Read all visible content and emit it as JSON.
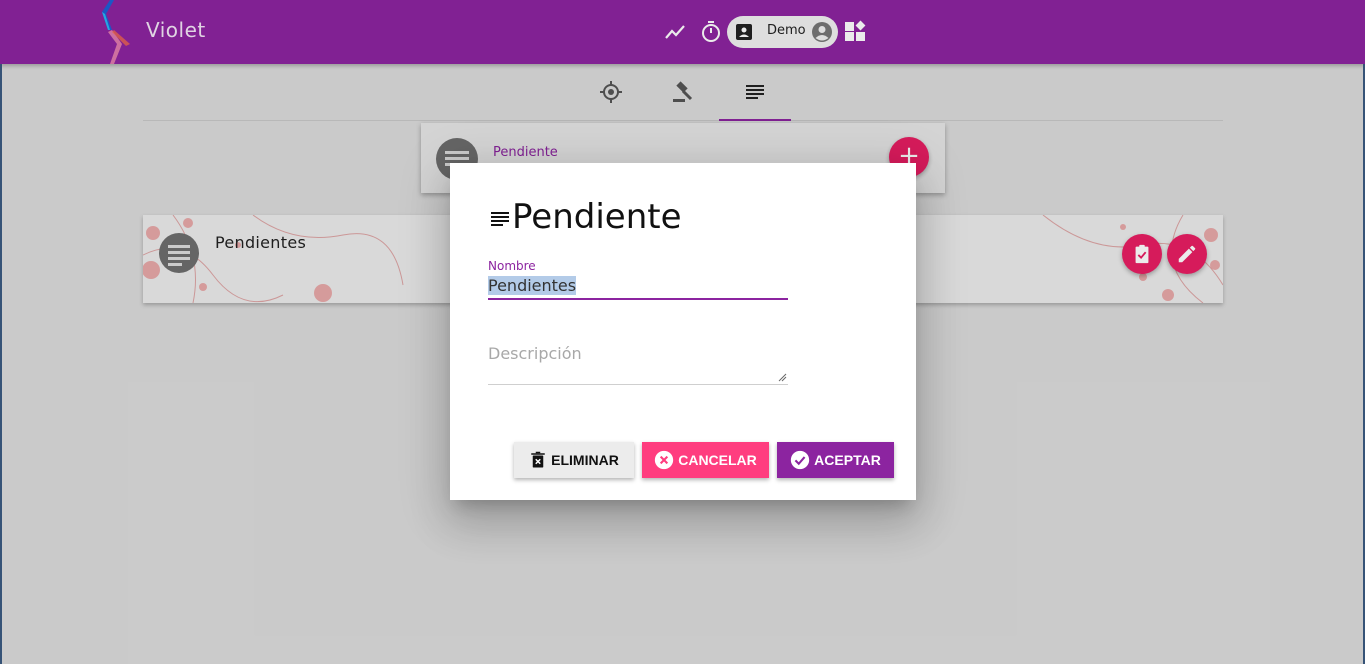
{
  "app": {
    "title": "Violet",
    "user_name": "Demo"
  },
  "tabs": [
    {
      "icon": "target-icon",
      "active": false
    },
    {
      "icon": "gavel-icon",
      "active": false
    },
    {
      "icon": "list-icon",
      "active": true
    }
  ],
  "category_card": {
    "label": "Pendiente",
    "add_button": "+"
  },
  "list_card": {
    "title": "Pendientes"
  },
  "dialog": {
    "title": "Pendiente",
    "name_label": "Nombre",
    "name_value": "Pendientes",
    "description_placeholder": "Descripción",
    "delete_label": "ELIMINAR",
    "cancel_label": "CANCELAR",
    "accept_label": "ACEPTAR"
  },
  "colors": {
    "primary": "#8c24a0",
    "accent": "#e91e63",
    "cancel": "#ff3d7f"
  }
}
